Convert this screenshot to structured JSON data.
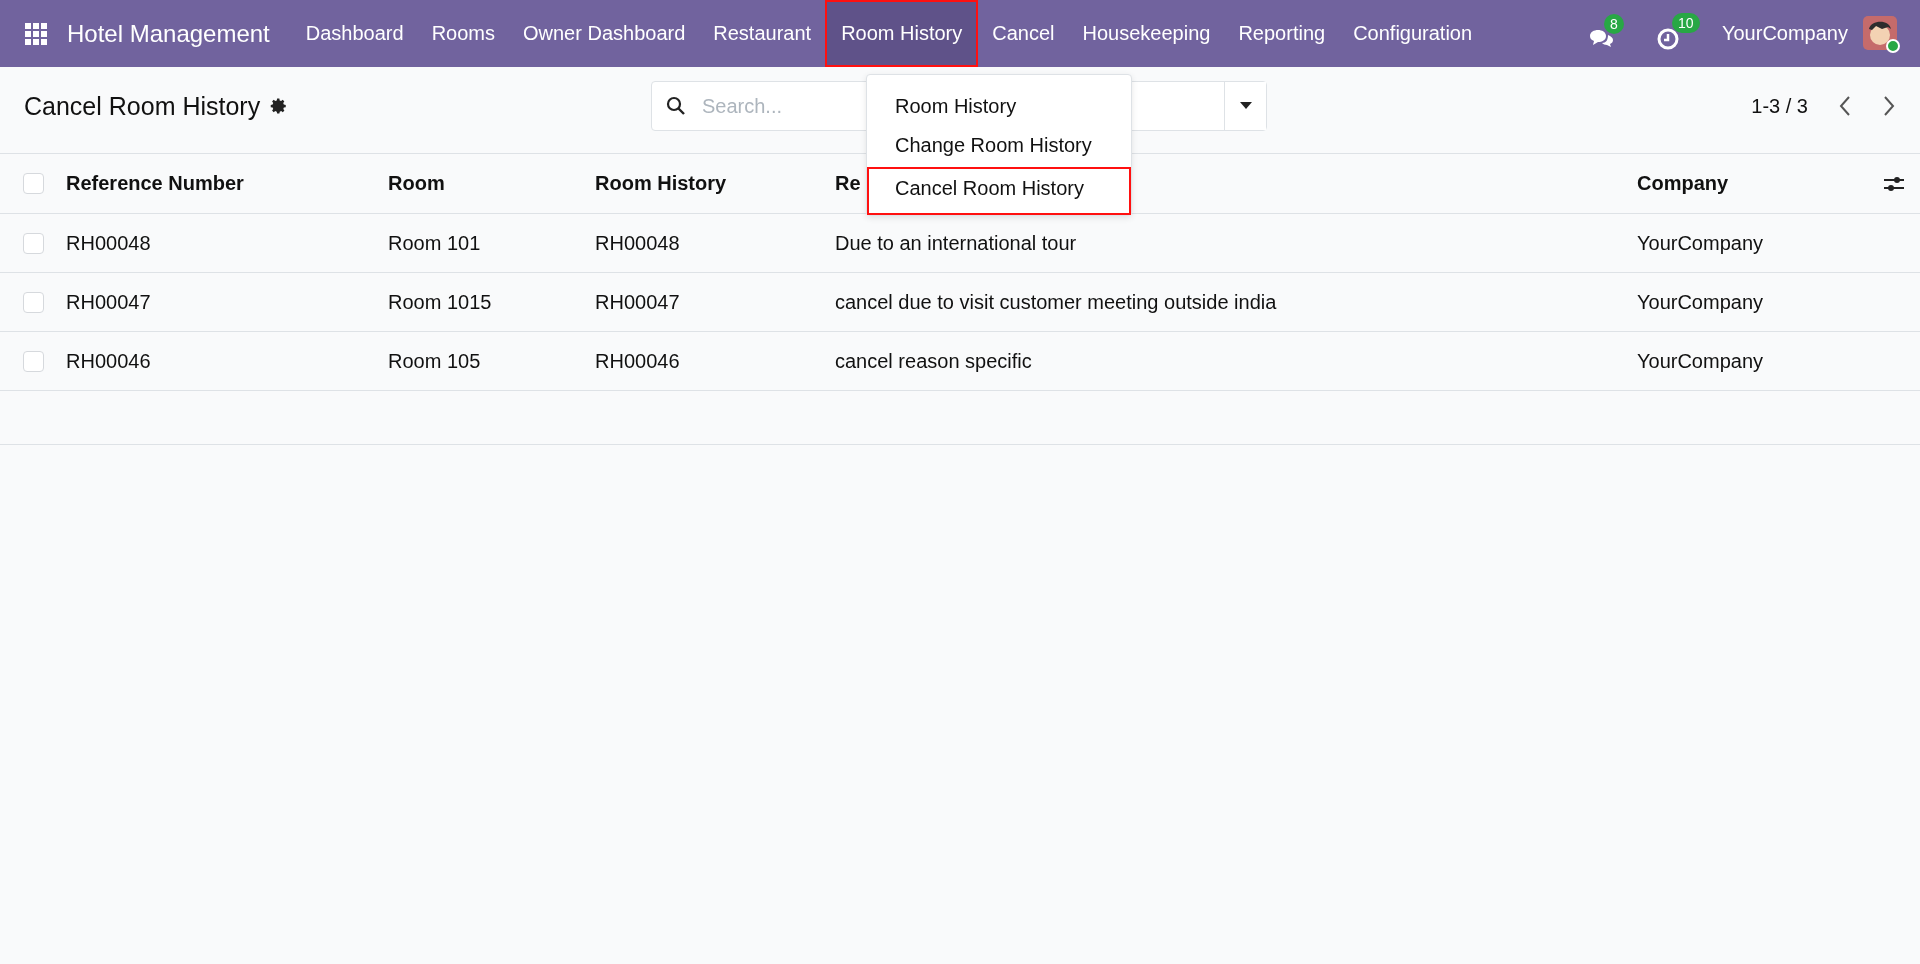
{
  "app": {
    "title": "Hotel Management"
  },
  "nav": [
    {
      "label": "Dashboard",
      "selected": false,
      "highlighted": false
    },
    {
      "label": "Rooms",
      "selected": false,
      "highlighted": false
    },
    {
      "label": "Owner Dashboard",
      "selected": false,
      "highlighted": false
    },
    {
      "label": "Restaurant",
      "selected": false,
      "highlighted": false
    },
    {
      "label": "Room History",
      "selected": true,
      "highlighted": true
    },
    {
      "label": "Cancel",
      "selected": false,
      "highlighted": false
    },
    {
      "label": "Housekeeping",
      "selected": false,
      "highlighted": false
    },
    {
      "label": "Reporting",
      "selected": false,
      "highlighted": false
    },
    {
      "label": "Configuration",
      "selected": false,
      "highlighted": false
    }
  ],
  "systray": {
    "messages_count": "8",
    "activities_count": "10",
    "company": "YourCompany"
  },
  "dropdown": {
    "items": [
      {
        "label": "Room History",
        "highlighted": false
      },
      {
        "label": "Change Room History",
        "highlighted": false
      },
      {
        "label": "Cancel Room History",
        "highlighted": true
      }
    ]
  },
  "breadcrumb": {
    "title": "Cancel Room History"
  },
  "search": {
    "placeholder": "Search..."
  },
  "pager": {
    "text": "1-3 / 3"
  },
  "table": {
    "all_checked": false,
    "columns": [
      "Reference Number",
      "Room",
      "Room History",
      "Re",
      "Company"
    ],
    "rows": [
      {
        "cells": [
          "RH00048",
          "Room 101",
          "RH00048",
          "Due to an international tour",
          "YourCompany"
        ],
        "checked": false
      },
      {
        "cells": [
          "RH00047",
          "Room 1015",
          "RH00047",
          "cancel due to visit customer meeting outside india",
          "YourCompany"
        ],
        "checked": false
      },
      {
        "cells": [
          "RH00046",
          "Room 105",
          "RH00046",
          "cancel reason specific",
          "YourCompany"
        ],
        "checked": false
      }
    ]
  }
}
